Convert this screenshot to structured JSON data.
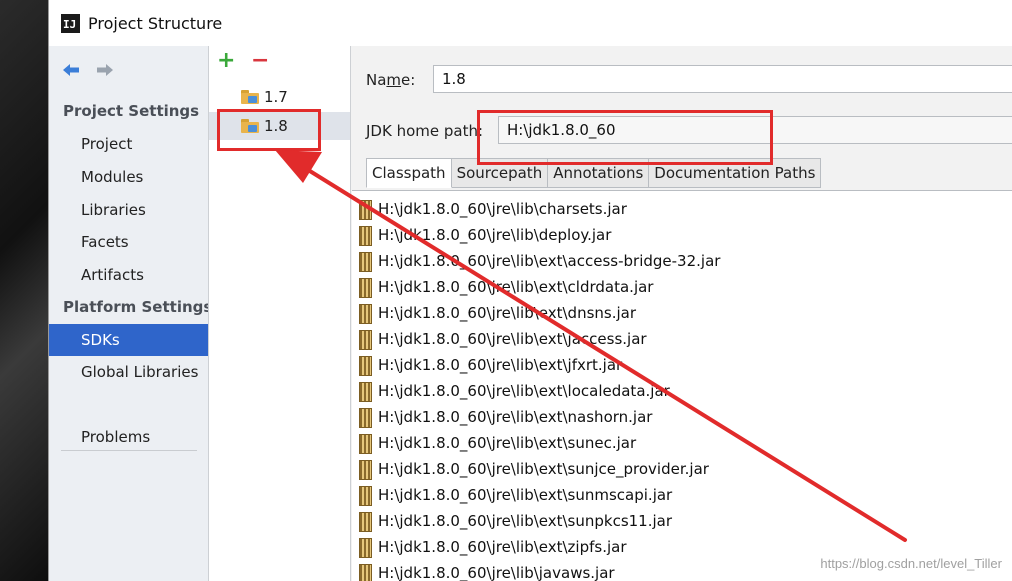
{
  "window": {
    "title": "Project Structure",
    "app_icon": "IJ"
  },
  "nav": {
    "back_icon": "arrow-left-icon",
    "forward_icon": "arrow-right-icon",
    "project_settings_header": "Project Settings",
    "project_items": [
      "Project",
      "Modules",
      "Libraries",
      "Facets",
      "Artifacts"
    ],
    "platform_settings_header": "Platform Settings",
    "platform_items": [
      "SDKs",
      "Global Libraries"
    ],
    "selected": "SDKs",
    "problems": "Problems"
  },
  "sdk_list": {
    "add_label": "+",
    "remove_label": "−",
    "items": [
      "1.7",
      "1.8"
    ],
    "selected": "1.8"
  },
  "sdk_detail": {
    "name_label_pre": "Na",
    "name_label_mnemonic": "m",
    "name_label_post": "e:",
    "name_value": "1.8",
    "jdk_home_label": "JDK home path:",
    "jdk_home_value": "H:\\jdk1.8.0_60",
    "tabs": [
      "Classpath",
      "Sourcepath",
      "Annotations",
      "Documentation Paths"
    ],
    "active_tab": "Classpath",
    "classpath": [
      "H:\\jdk1.8.0_60\\jre\\lib\\charsets.jar",
      "H:\\jdk1.8.0_60\\jre\\lib\\deploy.jar",
      "H:\\jdk1.8.0_60\\jre\\lib\\ext\\access-bridge-32.jar",
      "H:\\jdk1.8.0_60\\jre\\lib\\ext\\cldrdata.jar",
      "H:\\jdk1.8.0_60\\jre\\lib\\ext\\dnsns.jar",
      "H:\\jdk1.8.0_60\\jre\\lib\\ext\\jaccess.jar",
      "H:\\jdk1.8.0_60\\jre\\lib\\ext\\jfxrt.jar",
      "H:\\jdk1.8.0_60\\jre\\lib\\ext\\localedata.jar",
      "H:\\jdk1.8.0_60\\jre\\lib\\ext\\nashorn.jar",
      "H:\\jdk1.8.0_60\\jre\\lib\\ext\\sunec.jar",
      "H:\\jdk1.8.0_60\\jre\\lib\\ext\\sunjce_provider.jar",
      "H:\\jdk1.8.0_60\\jre\\lib\\ext\\sunmscapi.jar",
      "H:\\jdk1.8.0_60\\jre\\lib\\ext\\sunpkcs11.jar",
      "H:\\jdk1.8.0_60\\jre\\lib\\ext\\zipfs.jar",
      "H:\\jdk1.8.0_60\\jre\\lib\\javaws.jar"
    ]
  },
  "annotation": {
    "color": "#e12b2b"
  },
  "watermark": "https://blog.csdn.net/level_Tiller",
  "colors": {
    "selection": "#2f65ca",
    "add": "#3aa83a",
    "remove": "#d9363e"
  }
}
